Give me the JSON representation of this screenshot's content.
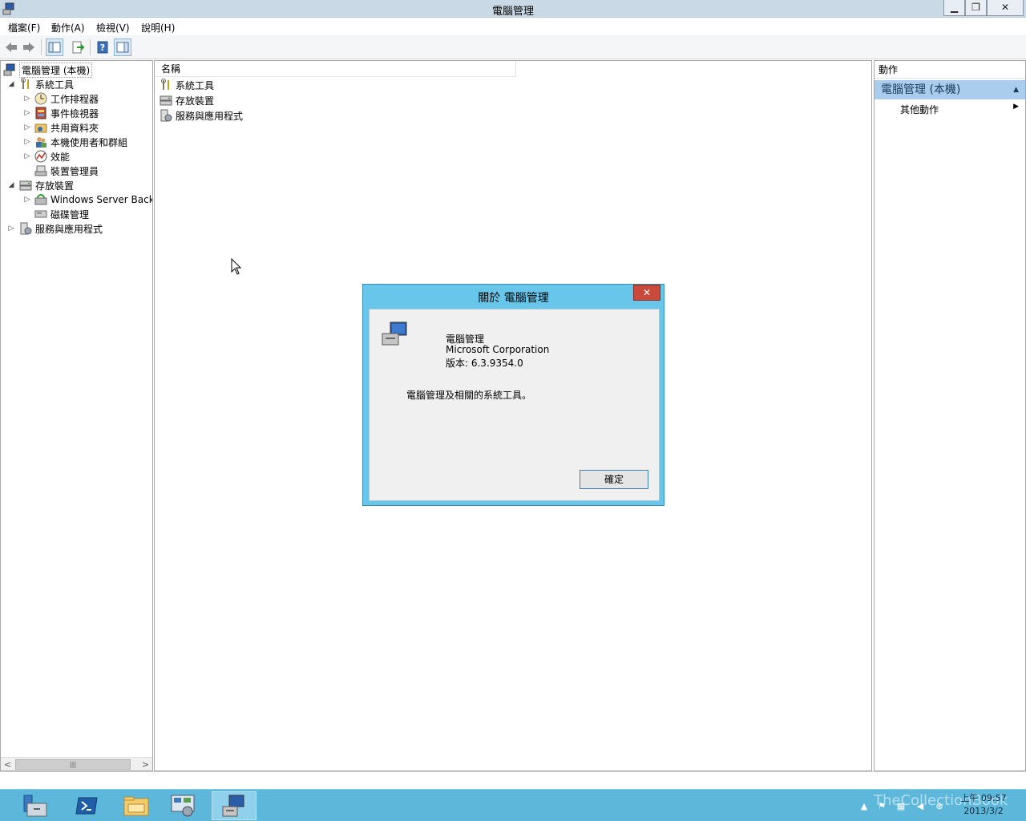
{
  "window": {
    "title": "電腦管理",
    "min_label": "▁",
    "max_label": "❐",
    "close_label": "✕"
  },
  "menu": {
    "items": [
      "檔案(F)",
      "動作(A)",
      "檢視(V)",
      "說明(H)"
    ]
  },
  "tree": {
    "root": "電腦管理 (本機)",
    "items": [
      {
        "label": "系統工具",
        "icon": "tools-icon"
      },
      {
        "label": "工作排程器",
        "icon": "clock-icon"
      },
      {
        "label": "事件檢視器",
        "icon": "event-viewer-icon"
      },
      {
        "label": "共用資料夾",
        "icon": "shared-folder-icon"
      },
      {
        "label": "本機使用者和群組",
        "icon": "users-icon"
      },
      {
        "label": "效能",
        "icon": "performance-icon"
      },
      {
        "label": "裝置管理員",
        "icon": "device-manager-icon"
      },
      {
        "label": "存放裝置",
        "icon": "storage-icon"
      },
      {
        "label": "Windows Server Backu",
        "icon": "backup-icon"
      },
      {
        "label": "磁碟管理",
        "icon": "disk-icon"
      },
      {
        "label": "服務與應用程式",
        "icon": "services-icon"
      }
    ]
  },
  "center": {
    "column_header": "名稱",
    "items": [
      {
        "label": "系統工具",
        "icon": "tools-icon"
      },
      {
        "label": "存放裝置",
        "icon": "storage-icon"
      },
      {
        "label": "服務與應用程式",
        "icon": "services-icon"
      }
    ]
  },
  "actions": {
    "header": "動作",
    "group": "電腦管理 (本機)",
    "item": "其他動作"
  },
  "dialog": {
    "title": "關於 電腦管理",
    "close_label": "✕",
    "product": "電腦管理",
    "company": "Microsoft Corporation",
    "version": "版本: 6.3.9354.0",
    "description": "電腦管理及相關的系統工具。",
    "ok_label": "確定"
  },
  "taskbar": {
    "clock_time": "上午 09:57",
    "clock_date": "2013/3/2",
    "watermark": "TheCollectionBook"
  },
  "colors": {
    "taskbar": "#5cb7db",
    "dialog_frame": "#67c6ea",
    "actions_group": "#aacdee",
    "titlebar": "#c9d9e5"
  }
}
